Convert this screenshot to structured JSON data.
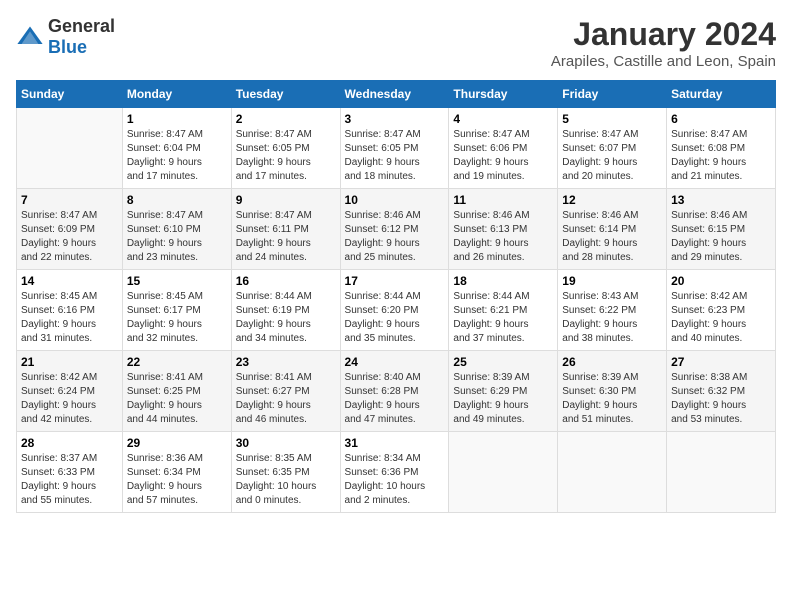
{
  "header": {
    "logo_general": "General",
    "logo_blue": "Blue",
    "title": "January 2024",
    "subtitle": "Arapiles, Castille and Leon, Spain"
  },
  "calendar": {
    "days_of_week": [
      "Sunday",
      "Monday",
      "Tuesday",
      "Wednesday",
      "Thursday",
      "Friday",
      "Saturday"
    ],
    "weeks": [
      [
        {
          "day": "",
          "info": ""
        },
        {
          "day": "1",
          "info": "Sunrise: 8:47 AM\nSunset: 6:04 PM\nDaylight: 9 hours\nand 17 minutes."
        },
        {
          "day": "2",
          "info": "Sunrise: 8:47 AM\nSunset: 6:05 PM\nDaylight: 9 hours\nand 17 minutes."
        },
        {
          "day": "3",
          "info": "Sunrise: 8:47 AM\nSunset: 6:05 PM\nDaylight: 9 hours\nand 18 minutes."
        },
        {
          "day": "4",
          "info": "Sunrise: 8:47 AM\nSunset: 6:06 PM\nDaylight: 9 hours\nand 19 minutes."
        },
        {
          "day": "5",
          "info": "Sunrise: 8:47 AM\nSunset: 6:07 PM\nDaylight: 9 hours\nand 20 minutes."
        },
        {
          "day": "6",
          "info": "Sunrise: 8:47 AM\nSunset: 6:08 PM\nDaylight: 9 hours\nand 21 minutes."
        }
      ],
      [
        {
          "day": "7",
          "info": "Sunrise: 8:47 AM\nSunset: 6:09 PM\nDaylight: 9 hours\nand 22 minutes."
        },
        {
          "day": "8",
          "info": "Sunrise: 8:47 AM\nSunset: 6:10 PM\nDaylight: 9 hours\nand 23 minutes."
        },
        {
          "day": "9",
          "info": "Sunrise: 8:47 AM\nSunset: 6:11 PM\nDaylight: 9 hours\nand 24 minutes."
        },
        {
          "day": "10",
          "info": "Sunrise: 8:46 AM\nSunset: 6:12 PM\nDaylight: 9 hours\nand 25 minutes."
        },
        {
          "day": "11",
          "info": "Sunrise: 8:46 AM\nSunset: 6:13 PM\nDaylight: 9 hours\nand 26 minutes."
        },
        {
          "day": "12",
          "info": "Sunrise: 8:46 AM\nSunset: 6:14 PM\nDaylight: 9 hours\nand 28 minutes."
        },
        {
          "day": "13",
          "info": "Sunrise: 8:46 AM\nSunset: 6:15 PM\nDaylight: 9 hours\nand 29 minutes."
        }
      ],
      [
        {
          "day": "14",
          "info": "Sunrise: 8:45 AM\nSunset: 6:16 PM\nDaylight: 9 hours\nand 31 minutes."
        },
        {
          "day": "15",
          "info": "Sunrise: 8:45 AM\nSunset: 6:17 PM\nDaylight: 9 hours\nand 32 minutes."
        },
        {
          "day": "16",
          "info": "Sunrise: 8:44 AM\nSunset: 6:19 PM\nDaylight: 9 hours\nand 34 minutes."
        },
        {
          "day": "17",
          "info": "Sunrise: 8:44 AM\nSunset: 6:20 PM\nDaylight: 9 hours\nand 35 minutes."
        },
        {
          "day": "18",
          "info": "Sunrise: 8:44 AM\nSunset: 6:21 PM\nDaylight: 9 hours\nand 37 minutes."
        },
        {
          "day": "19",
          "info": "Sunrise: 8:43 AM\nSunset: 6:22 PM\nDaylight: 9 hours\nand 38 minutes."
        },
        {
          "day": "20",
          "info": "Sunrise: 8:42 AM\nSunset: 6:23 PM\nDaylight: 9 hours\nand 40 minutes."
        }
      ],
      [
        {
          "day": "21",
          "info": "Sunrise: 8:42 AM\nSunset: 6:24 PM\nDaylight: 9 hours\nand 42 minutes."
        },
        {
          "day": "22",
          "info": "Sunrise: 8:41 AM\nSunset: 6:25 PM\nDaylight: 9 hours\nand 44 minutes."
        },
        {
          "day": "23",
          "info": "Sunrise: 8:41 AM\nSunset: 6:27 PM\nDaylight: 9 hours\nand 46 minutes."
        },
        {
          "day": "24",
          "info": "Sunrise: 8:40 AM\nSunset: 6:28 PM\nDaylight: 9 hours\nand 47 minutes."
        },
        {
          "day": "25",
          "info": "Sunrise: 8:39 AM\nSunset: 6:29 PM\nDaylight: 9 hours\nand 49 minutes."
        },
        {
          "day": "26",
          "info": "Sunrise: 8:39 AM\nSunset: 6:30 PM\nDaylight: 9 hours\nand 51 minutes."
        },
        {
          "day": "27",
          "info": "Sunrise: 8:38 AM\nSunset: 6:32 PM\nDaylight: 9 hours\nand 53 minutes."
        }
      ],
      [
        {
          "day": "28",
          "info": "Sunrise: 8:37 AM\nSunset: 6:33 PM\nDaylight: 9 hours\nand 55 minutes."
        },
        {
          "day": "29",
          "info": "Sunrise: 8:36 AM\nSunset: 6:34 PM\nDaylight: 9 hours\nand 57 minutes."
        },
        {
          "day": "30",
          "info": "Sunrise: 8:35 AM\nSunset: 6:35 PM\nDaylight: 10 hours\nand 0 minutes."
        },
        {
          "day": "31",
          "info": "Sunrise: 8:34 AM\nSunset: 6:36 PM\nDaylight: 10 hours\nand 2 minutes."
        },
        {
          "day": "",
          "info": ""
        },
        {
          "day": "",
          "info": ""
        },
        {
          "day": "",
          "info": ""
        }
      ]
    ]
  }
}
